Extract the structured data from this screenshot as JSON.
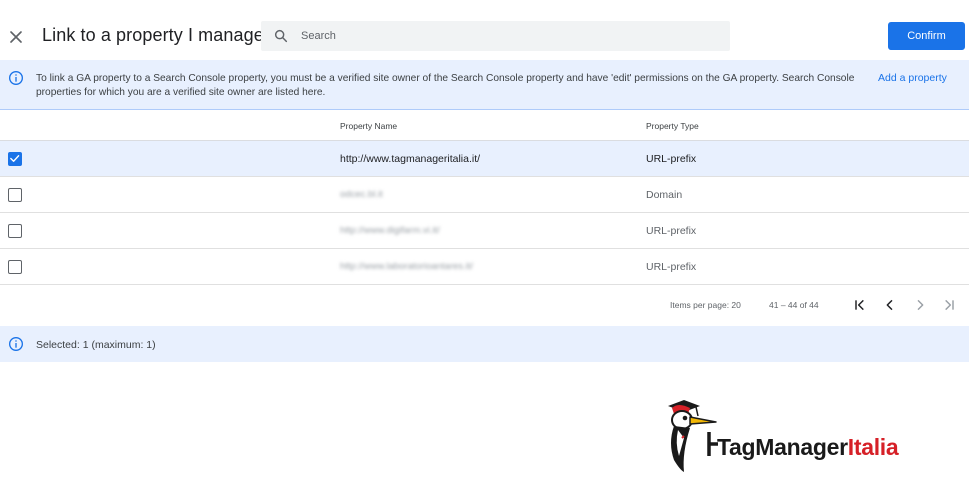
{
  "header": {
    "title": "Link to a property I manage",
    "search_placeholder": "Search",
    "confirm_label": "Confirm"
  },
  "info": {
    "text": "To link a GA property to a Search Console property, you must be a verified site owner of the Search Console property and have 'edit' permissions on the GA property. Search Console properties for which you are a verified site owner are listed here.",
    "add_link": "Add a property"
  },
  "table": {
    "columns": [
      "Property Name",
      "Property Type"
    ],
    "rows": [
      {
        "name": "http://www.tagmanageritalia.it/",
        "type": "URL-prefix",
        "selected": true
      },
      {
        "name": "odcec.bl.it",
        "type": "Domain",
        "selected": false
      },
      {
        "name": "http://www.digifarm.vi.it/",
        "type": "URL-prefix",
        "selected": false
      },
      {
        "name": "http://www.laboratorioantares.it/",
        "type": "URL-prefix",
        "selected": false
      }
    ]
  },
  "paginator": {
    "items_per_page": "Items per page: 20",
    "range": "41 – 44 of 44"
  },
  "status": {
    "text": "Selected: 1 (maximum: 1)"
  },
  "logo": {
    "word1": "TagManager",
    "word2": "Italia"
  },
  "colors": {
    "accent": "#1a73e8",
    "banner": "#e8f0fe",
    "brand_red": "#d62027"
  }
}
